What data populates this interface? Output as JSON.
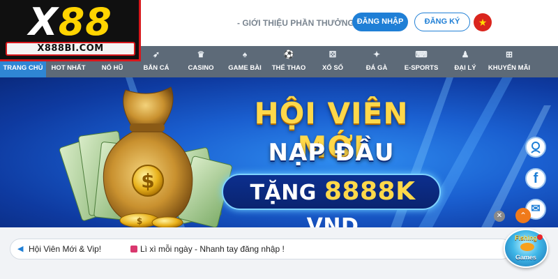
{
  "brand": {
    "logo_main_a": "X",
    "logo_main_b": "88",
    "logo_sub": "X888BI.COM"
  },
  "header": {
    "intro_link": "- GIỚI THIỆU PHẦN THƯỞNG",
    "login_label": "ĐĂNG NHẬP",
    "register_label": "ĐĂNG KÝ",
    "flag_icon": "vietnam-flag-icon",
    "accent_color": "#1f7fd6"
  },
  "nav": {
    "background": "#5d6a78",
    "active_color": "#2f86d4",
    "items": [
      {
        "label": "TRANG CHỦ",
        "icon": "",
        "active": true
      },
      {
        "label": "HOT NHẤT",
        "icon": ""
      },
      {
        "label": "NỔ HŨ",
        "icon": ""
      },
      {
        "label": "BẮN CÁ",
        "icon": "fish-icon"
      },
      {
        "label": "CASINO",
        "icon": "dealer-icon"
      },
      {
        "label": "GAME BÀI",
        "icon": "cards-icon"
      },
      {
        "label": "THỂ THAO",
        "icon": "soccer-ball-icon"
      },
      {
        "label": "XỔ SỐ",
        "icon": "lottery-icon"
      },
      {
        "label": "ĐÁ GÀ",
        "icon": "rooster-icon"
      },
      {
        "label": "E-SPORTS",
        "icon": "gamepad-icon"
      },
      {
        "label": "ĐẠI LÝ",
        "icon": "agent-icon"
      },
      {
        "label": "KHUYẾN MÃI",
        "icon": "gift-icon"
      }
    ]
  },
  "banner": {
    "line1": "HỘI VIÊN MỚI",
    "line2": "NẠP ĐẦU",
    "pill_prefix": "TẶNG ",
    "pill_amount": "8888K",
    "pill_suffix": " VND",
    "bag_symbol": "$",
    "coin_symbol": "$"
  },
  "float_buttons": [
    {
      "icon": "support-agent-icon"
    },
    {
      "icon": "facebook-icon",
      "glyph": "f"
    },
    {
      "icon": "mail-icon",
      "glyph": "✉"
    }
  ],
  "marquee": {
    "text1": "Hội Viên Mới & Vip!",
    "text2": "Lì xì mỗi ngày - Nhanh tay đăng nhập !"
  },
  "game_badge": {
    "top": "Fishing",
    "bottom": "Games"
  }
}
